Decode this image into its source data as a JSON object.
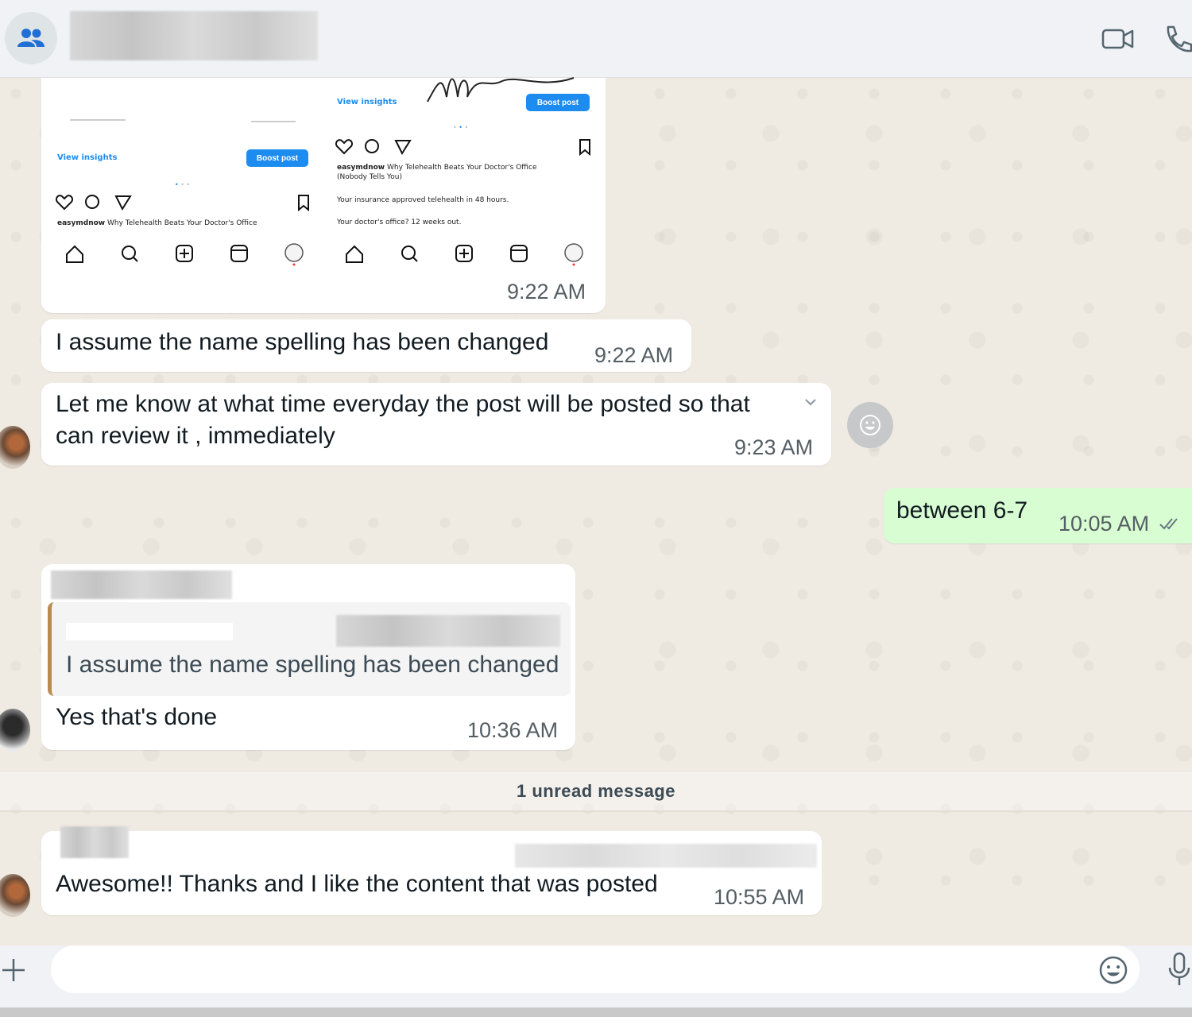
{
  "header": {
    "video_call_icon": "video-camera-icon",
    "voice_call_icon": "phone-icon"
  },
  "shared_screenshot": {
    "left_panel": {
      "view_insights": "View insights",
      "boost_post": "Boost post",
      "caption_user": "easymdnow",
      "caption_text": "Why Telehealth Beats Your Doctor's Office"
    },
    "right_panel": {
      "view_insights": "View insights",
      "boost_post": "Boost post",
      "caption_user": "easymdnow",
      "caption_text": "Why Telehealth Beats Your Doctor's Office",
      "caption_text2": "(Nobody Tells You)",
      "line1": "Your insurance approved telehealth in 48 hours.",
      "line2": "Your doctor's office? 12 weeks out."
    },
    "time": "9:22 AM"
  },
  "messages": [
    {
      "text": "I assume the name spelling has been changed",
      "time": "9:22 AM"
    },
    {
      "text_line1": "Let me know at what time everyday the post will be posted so that",
      "text_line2": "can review it , immediately",
      "time": "9:23 AM"
    },
    {
      "text": "between 6-7",
      "time": "10:05 AM",
      "status": "double-check-icon"
    },
    {
      "quoted_text": "I assume the name spelling has been changed",
      "text": "Yes that's done",
      "time": "10:36 AM"
    },
    {
      "text": "Awesome!! Thanks and I like the content that was posted",
      "time": "10:55 AM"
    }
  ],
  "unread_divider": "1 unread message",
  "composer": {
    "placeholder": "",
    "attach_icon": "plus-icon",
    "emoji_icon": "smiley-icon",
    "mic_icon": "microphone-icon"
  }
}
